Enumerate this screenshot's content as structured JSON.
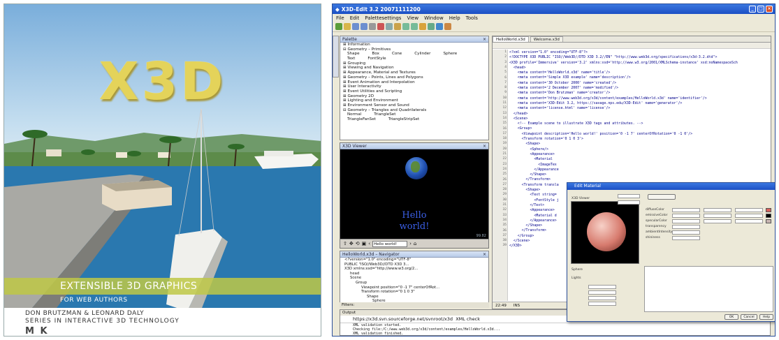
{
  "cover": {
    "title": "X3D",
    "subtitle_band": "EXTENSIBLE 3D GRAPHICS",
    "audience": "FOR WEB AUTHORS",
    "authors": "DON BRUTZMAN & LEONARD DALY",
    "series": "SERIES IN INTERACTIVE 3D TECHNOLOGY",
    "publisher_logo": "M K",
    "colors": {
      "title": "#e4d35a",
      "band": "#bec846"
    }
  },
  "app": {
    "window_title": "X3D-Edit 3.2 20071111200",
    "menu": [
      "File",
      "Edit",
      "Palettesettings",
      "View",
      "Window",
      "Help",
      "Tools"
    ],
    "palette": {
      "header": "Palette",
      "rows": [
        "Information",
        "Geometry – Primitives",
        "Grouping",
        "Viewing and Navigation",
        "Appearance, Material and Textures",
        "Geometry – Points, Lines and Polygons",
        "Event Animation and Interpolation",
        "User Interactivity",
        "Event Utilities and Scripting",
        "Geometry 2D",
        "Lighting and Environment",
        "Environment Sensor and Sound",
        "Geometry – Triangles and Quadrilaterals"
      ],
      "primitives": [
        "Shape",
        "Box",
        "Cone",
        "Cylinder",
        "Sphere"
      ],
      "text_items": [
        "Text",
        "FontStyle"
      ],
      "triangle_items": [
        "Normal",
        "TriangleSet",
        "TriangleFanSet",
        "TriangleStripSet"
      ]
    },
    "viewer": {
      "header": "X3D Viewer",
      "hello_line1": "Hello",
      "hello_line2": "world!",
      "viewpoint_field": "Hello world!",
      "coords": "99.82"
    },
    "navigator": {
      "header": "HelloWorld.x3d – Navigator",
      "rows": [
        "<?version=\"1.0\" encoding=\"UTF-8\"",
        "PUBLIC \"ISO//Web3D//DTD X3D 3...",
        "X3D xmlns:xsd=\"http://www.w3.org/2...",
        "head",
        "Scene",
        "Group",
        "Viewpoint position=\"0 -1 7\" centerOfRot...",
        "Transform rotation=\"0 1 0 3\"",
        "Shape",
        "Sphere"
      ],
      "filters_label": "Filters:"
    },
    "editor": {
      "tabs": [
        "HelloWorld.x3d",
        "Welcome.x3d"
      ],
      "lines": [
        "<?xml version=\"1.0\" encoding=\"UTF-8\"?>",
        "<!DOCTYPE X3D PUBLIC \"ISO//Web3D//DTD X3D 3.2//EN\" \"http://www.web3d.org/specifications/x3d-3.2.dtd\">",
        "<X3D profile='Immersive' version='3.2' xmlns:xsd='http://www.w3.org/2001/XMLSchema-instance' xsd:noNamespaceSch",
        "  <head>",
        "    <meta content='HelloWorld.x3d' name='title'/>",
        "    <meta content='Simple X3D example' name='description'/>",
        "    <meta content='30 October 2000' name='created'/>",
        "    <meta content='2 December 2007' name='modified'/>",
        "    <meta content='Don Brutzman' name='creator'/>",
        "    <meta content='http://www.web3d.org/x3d/content/examples/HelloWorld.x3d' name='identifier'/>",
        "    <meta content='X3D-Edit 3.2, https://savage.nps.edu/X3D-Edit' name='generator'/>",
        "    <meta content='license.html' name='license'/>",
        "  </head>",
        "  <Scene>",
        "    <!-- Example scene to illustrate X3D tags and attributes. -->",
        "    <Group>",
        "      <Viewpoint description='Hello world!' position='0 -1 7' centerOfRotation='0 -1 0'/>",
        "      <Transform rotation='0 1 0 3'>",
        "        <Shape>",
        "          <Sphere/>",
        "          <Appearance>",
        "            <Material",
        "              <ImageTex",
        "            </Appearance",
        "          </Shape>",
        "        </Transform>",
        "      <Transform transla",
        "        <Shape>",
        "          <Text string=",
        "            <FontStyle j",
        "          </Text>",
        "          <Appearance>",
        "            <Material d",
        "          </Appearance>",
        "        </Shape>",
        "      </Transform>",
        "    </Group>",
        "  </Scene>",
        "</X3D>"
      ],
      "status_position": "22:49",
      "status_mode": "INS"
    },
    "output": {
      "header": "Output",
      "url": "https://x3d.svn.sourceforge.net/svnroot/x3d",
      "check_label": "XML check",
      "messages": [
        "XML validation started.",
        "Checking file:/C:/www.web3d.org/x3d/content/examples/HelloWorld.x3d...",
        "XML validation finished."
      ]
    },
    "material_dialog": {
      "title": "Edit Material",
      "preview_label": "X3D Viewer",
      "labels": [
        "diffuseColor",
        "emissiveColor",
        "specularColor",
        "transparency",
        "ambientIntensity",
        "shininess"
      ],
      "buttons": [
        "OK",
        "Cancel",
        "Help"
      ],
      "geometry_label": "Sphere",
      "lights_label": "Lights"
    }
  }
}
